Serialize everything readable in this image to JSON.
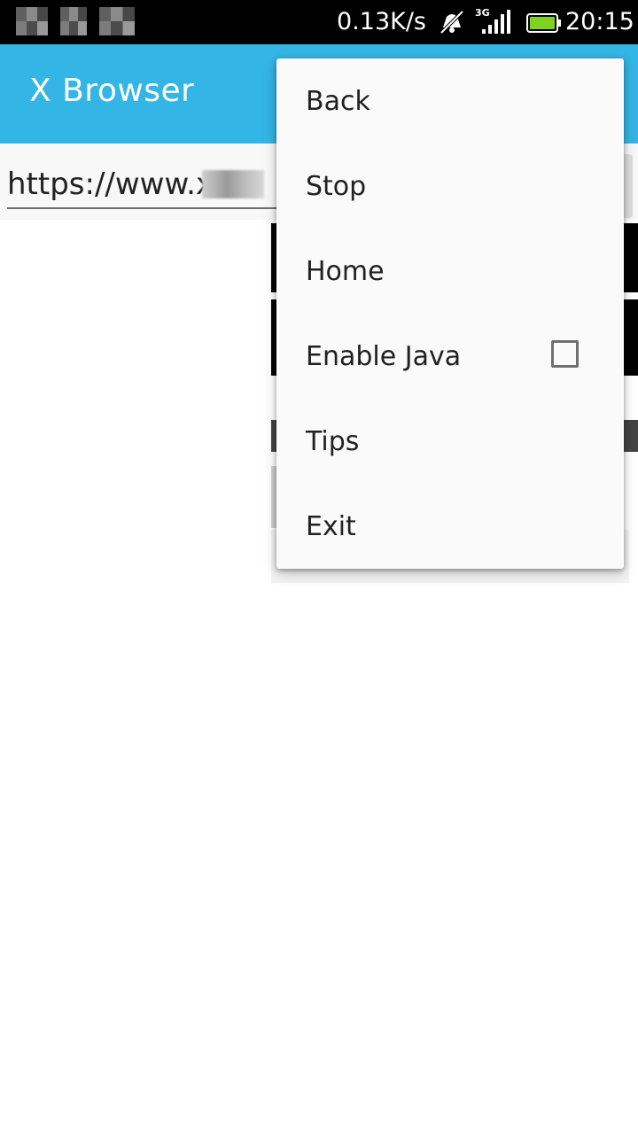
{
  "status_bar": {
    "net_speed": "0.13K/s",
    "network_type": "3G",
    "time": "20:15",
    "icons": [
      "notification-icon",
      "notification-icon",
      "notification-icon",
      "mute-icon",
      "signal-icon",
      "battery-icon"
    ]
  },
  "app_bar": {
    "title": "X Browser",
    "color": "#33b5e5"
  },
  "url_bar": {
    "value": "https://www.x"
  },
  "menu": {
    "items": [
      {
        "label": "Back"
      },
      {
        "label": "Stop"
      },
      {
        "label": "Home"
      },
      {
        "label": "Enable Java",
        "checkbox": true,
        "checked": false
      },
      {
        "label": "Tips"
      },
      {
        "label": "Exit"
      }
    ]
  }
}
